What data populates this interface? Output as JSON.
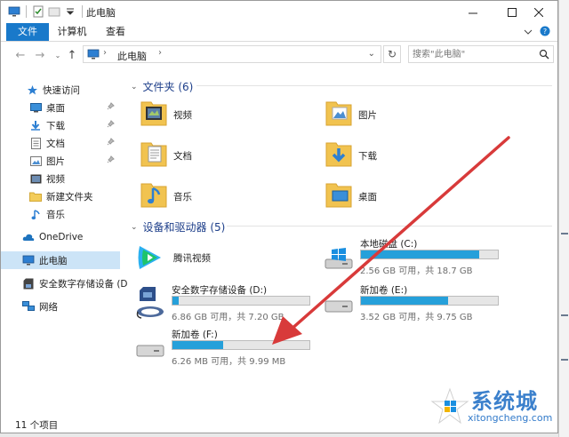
{
  "window": {
    "title": "此电脑"
  },
  "ribbon": {
    "tabs": [
      "文件",
      "计算机",
      "查看"
    ]
  },
  "address": {
    "location": "此电脑",
    "search_placeholder": "搜索\"此电脑\""
  },
  "nav": {
    "quick_access": "快速访问",
    "pinned": [
      {
        "label": "桌面",
        "icon": "desktop-icon"
      },
      {
        "label": "下载",
        "icon": "download-icon"
      },
      {
        "label": "文档",
        "icon": "document-icon"
      },
      {
        "label": "图片",
        "icon": "picture-icon"
      }
    ],
    "recent": [
      {
        "label": "视频",
        "icon": "video-icon"
      },
      {
        "label": "新建文件夹",
        "icon": "folder-icon"
      },
      {
        "label": "音乐",
        "icon": "music-icon"
      }
    ],
    "onedrive": "OneDrive",
    "this_pc": "此电脑",
    "secure_device": "安全数字存储设备 (D",
    "network": "网络"
  },
  "content": {
    "folders_header": "文件夹 (6)",
    "folders": [
      {
        "label": "视频",
        "icon": "video-folder-icon"
      },
      {
        "label": "图片",
        "icon": "picture-folder-icon"
      },
      {
        "label": "文档",
        "icon": "document-folder-icon"
      },
      {
        "label": "下载",
        "icon": "download-folder-icon"
      },
      {
        "label": "音乐",
        "icon": "music-folder-icon"
      },
      {
        "label": "桌面",
        "icon": "desktop-folder-icon"
      }
    ],
    "devices_header": "设备和驱动器 (5)",
    "devices": {
      "tencent": {
        "name": "腾讯视频"
      },
      "c": {
        "name": "本地磁盘 (C:)",
        "info": "2.56 GB 可用，共 18.7 GB",
        "used_fraction": 0.863
      },
      "d": {
        "name": "安全数字存储设备 (D:)",
        "info": "6.86 GB 可用，共 7.20 GB",
        "used_fraction": 0.047
      },
      "e": {
        "name": "新加卷 (E:)",
        "info": "3.52 GB 可用，共 9.75 GB",
        "used_fraction": 0.639
      },
      "f": {
        "name": "新加卷 (F:)",
        "info": "6.26 MB 可用，共 9.99 MB",
        "used_fraction": 0.373
      }
    }
  },
  "status": {
    "count": "11 个项目"
  },
  "watermark": {
    "brand": "系统城",
    "url": "xitongcheng.com"
  },
  "colors": {
    "accent": "#1979ca",
    "selection": "#cce4f7",
    "drive_bar": "#26a0da",
    "arrow": "#d83a3a"
  }
}
